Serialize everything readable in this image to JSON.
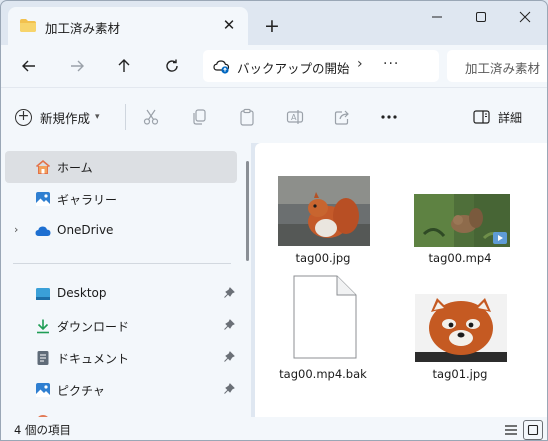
{
  "window": {
    "tab_title": "加工済み素材",
    "colors": {
      "accent": "#0067c0",
      "folder": "#f2c14e",
      "chrome": "#dfe7f1",
      "surface": "#f3f7fb",
      "selected": "#dcdfe3"
    }
  },
  "address_bar": {
    "breadcrumb": "バックアップの開始",
    "search_placeholder": "加工済み素材"
  },
  "command_bar": {
    "new_label": "新規作成",
    "details_label": "詳細"
  },
  "sidebar": {
    "items": [
      {
        "label": "ホーム",
        "icon": "home-icon",
        "selected": true
      },
      {
        "label": "ギャラリー",
        "icon": "gallery-icon"
      },
      {
        "label": "OneDrive",
        "icon": "cloud-icon",
        "expandable": true
      },
      {
        "label": "Desktop",
        "icon": "desktop-icon",
        "pinned": true
      },
      {
        "label": "ダウンロード",
        "icon": "download-icon",
        "pinned": true
      },
      {
        "label": "ドキュメント",
        "icon": "document-icon",
        "pinned": true
      },
      {
        "label": "ピクチャ",
        "icon": "pictures-icon",
        "pinned": true
      }
    ]
  },
  "files": [
    {
      "name": "tag00.jpg",
      "type": "image"
    },
    {
      "name": "tag00.mp4",
      "type": "video"
    },
    {
      "name": "tag00.mp4.bak",
      "type": "generic"
    },
    {
      "name": "tag01.jpg",
      "type": "image"
    }
  ],
  "status_bar": {
    "item_count": "4 個の項目"
  }
}
